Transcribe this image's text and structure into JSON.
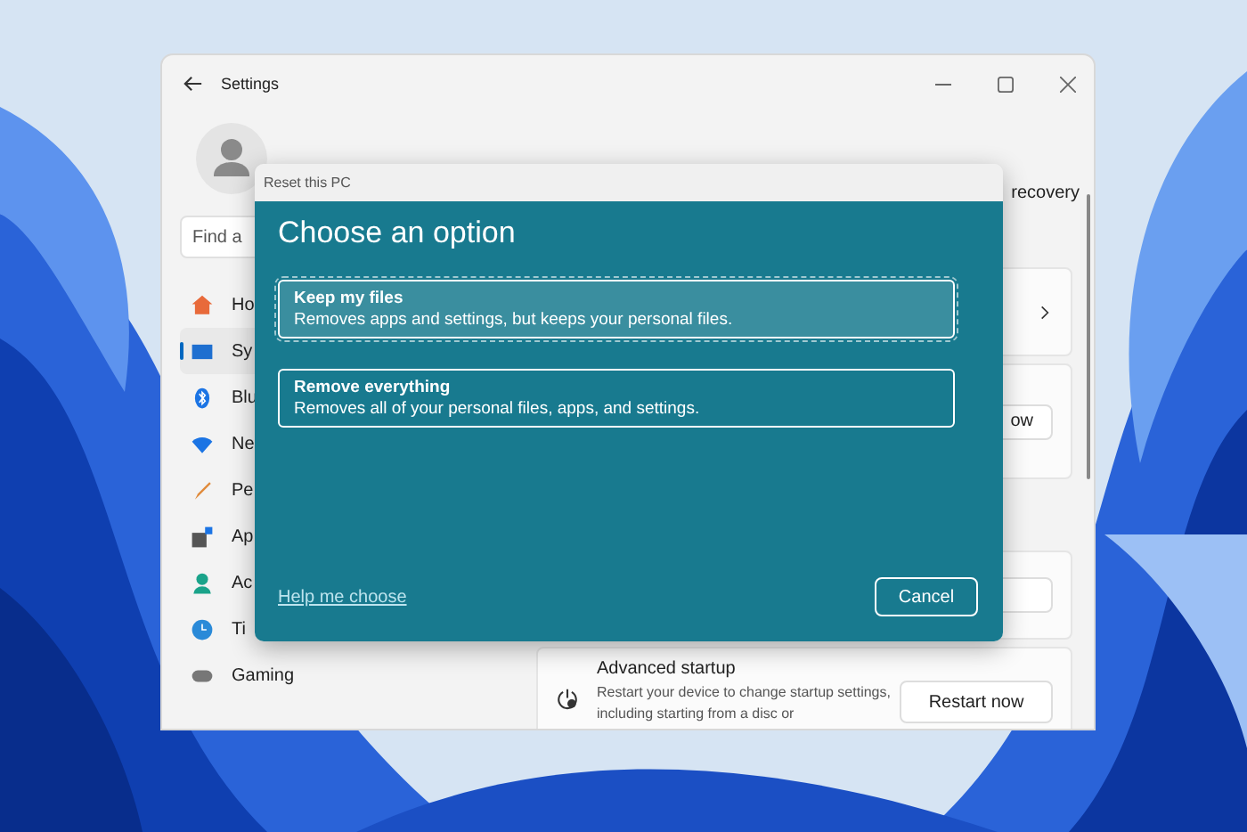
{
  "settings_window": {
    "title": "Settings",
    "search": {
      "placeholder": "Find a"
    },
    "sidebar": {
      "items": [
        {
          "label": "Ho",
          "selected": false
        },
        {
          "label": "Sy",
          "selected": true
        },
        {
          "label": "Blu",
          "selected": false
        },
        {
          "label": "Ne",
          "selected": false
        },
        {
          "label": "Pe",
          "selected": false
        },
        {
          "label": "Ap",
          "selected": false
        },
        {
          "label": "Ac",
          "selected": false
        },
        {
          "label": "Ti",
          "selected": false
        },
        {
          "label": "Gaming",
          "selected": false
        }
      ]
    },
    "header_fragment": "recovery",
    "cards": [
      {
        "kind": "chevron"
      },
      {
        "kind": "button",
        "button": "ow"
      },
      {
        "kind": "blank_button"
      },
      {
        "kind": "action",
        "title": "Advanced startup",
        "description": "Restart your device to change startup settings, including starting from a disc or",
        "button": "Restart now"
      }
    ]
  },
  "dialog": {
    "title": "Reset this PC",
    "heading": "Choose an option",
    "options": [
      {
        "title": "Keep my files",
        "description": "Removes apps and settings, but keeps your personal files.",
        "selected": true
      },
      {
        "title": "Remove everything",
        "description": "Removes all of your personal files, apps, and settings.",
        "selected": false
      }
    ],
    "help_link": "Help me choose",
    "cancel": "Cancel"
  }
}
